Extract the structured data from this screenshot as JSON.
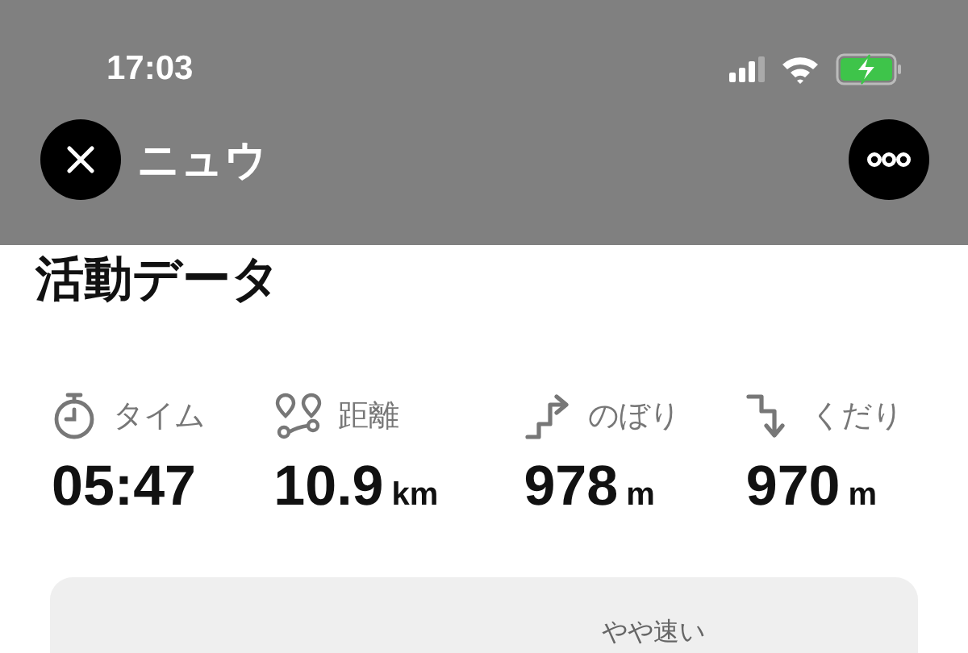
{
  "status_bar": {
    "time": "17:03"
  },
  "header": {
    "title": "ニュウ"
  },
  "section_title": "活動データ",
  "stats": [
    {
      "kind": "time",
      "label": "タイム",
      "value": "05:47"
    },
    {
      "kind": "distance",
      "label": "距離",
      "value": "10.9",
      "unit": "km"
    },
    {
      "kind": "ascent",
      "label": "のぼり",
      "value": "978",
      "unit": "m"
    },
    {
      "kind": "descent",
      "label": "くだり",
      "value": "970",
      "unit": "m"
    }
  ],
  "card": {
    "pace_label": "やや速い"
  }
}
